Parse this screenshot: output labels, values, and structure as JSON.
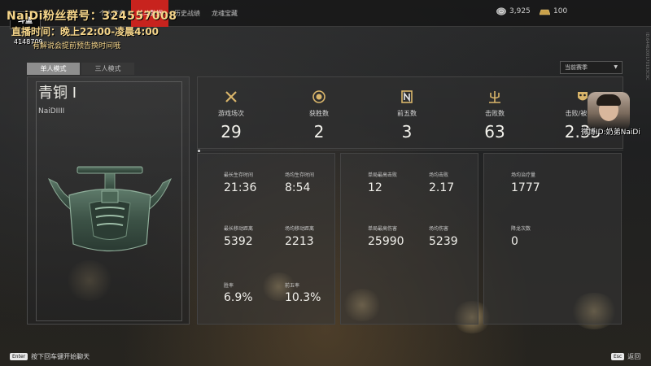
{
  "topbar": {
    "tabs": [
      {
        "label": "个人信息"
      },
      {
        "label": "战斗数据"
      },
      {
        "label": "历史战绩"
      },
      {
        "label": "龙魂宝藏"
      }
    ],
    "silver_amount": "3,925",
    "gold_amount": "100"
  },
  "side_id": "ID:6446200170193C9C",
  "overlay": {
    "line1": "NaiDi粉丝群号：324557008",
    "line2": "直播时间：晚上22:00-凌晨4:00",
    "line3": "有解说会提前预告换时间哦",
    "room_number": "4148709",
    "logo_text": "斗鱼"
  },
  "modes": {
    "solo": "单人模式",
    "trio": "三人模式",
    "season_select": "当前赛季"
  },
  "rank": {
    "title": "青铜 I",
    "player": "NaiDIIII"
  },
  "summary": [
    {
      "label": "游戏场次",
      "value": "29",
      "icon": "swords-icon"
    },
    {
      "label": "获胜数",
      "value": "2",
      "icon": "laurel-medal-icon"
    },
    {
      "label": "前五数",
      "value": "3",
      "icon": "top-five-icon"
    },
    {
      "label": "击败数",
      "value": "63",
      "icon": "trident-icon"
    },
    {
      "label": "击败/被击败",
      "value": "2.33",
      "icon": "mask-icon"
    }
  ],
  "details": {
    "panel1": [
      {
        "label": "最长生存时间",
        "value": "21:36"
      },
      {
        "label": "场均生存时间",
        "value": "8:54"
      },
      {
        "label": "最长移动距离",
        "value": "5392"
      },
      {
        "label": "场均移动距离",
        "value": "2213"
      },
      {
        "label": "胜率",
        "value": "6.9%"
      },
      {
        "label": "前五率",
        "value": "10.3%"
      }
    ],
    "panel2": [
      {
        "label": "单局最高击败",
        "value": "12"
      },
      {
        "label": "场均击败",
        "value": "2.17"
      },
      {
        "label": "单局最高伤害",
        "value": "25990"
      },
      {
        "label": "场均伤害",
        "value": "5239"
      }
    ],
    "panel3": [
      {
        "label": "场均治疗量",
        "value": "1777"
      },
      {
        "label": "降龙次数",
        "value": "0"
      }
    ]
  },
  "webcam": {
    "label": "微博ID:奶弟NaiDi"
  },
  "bottom": {
    "enter_key": "Enter",
    "enter_hint": "按下回车键开始聊天",
    "esc_key": "Esc",
    "esc_label": "返回"
  }
}
